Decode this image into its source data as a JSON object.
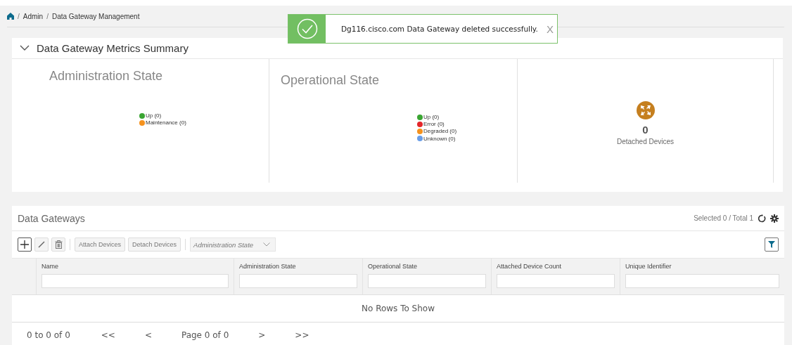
{
  "breadcrumb": {
    "separator": "/",
    "items": [
      "Admin",
      "Data Gateway Management"
    ]
  },
  "toast": {
    "message": "Dg116.cisco.com Data Gateway deleted successfully.",
    "close": "X"
  },
  "summary": {
    "title": "Data Gateway Metrics Summary",
    "expanded": true,
    "admin_state": {
      "title": "Administration State",
      "legend": [
        {
          "label": "Up (0)",
          "color": "#3aa532"
        },
        {
          "label": "Maintenance (0)",
          "color": "#f5921e"
        }
      ]
    },
    "operational_state": {
      "title": "Operational State",
      "legend": [
        {
          "label": "Up (0)",
          "color": "#3aa532"
        },
        {
          "label": "Error (0)",
          "color": "#e3262b"
        },
        {
          "label": "Degraded (0)",
          "color": "#f5921e"
        },
        {
          "label": "Unknown (0)",
          "color": "#6a9ee8"
        }
      ]
    },
    "detached": {
      "count": "0",
      "label": "Detached Devices"
    }
  },
  "gateways": {
    "title": "Data Gateways",
    "selection": "Selected 0 / Total 1",
    "toolbar": {
      "buttons": [
        "Attach Devices",
        "Detach Devices"
      ],
      "dropdown": "Administration State"
    },
    "columns": [
      "Name",
      "Administration State",
      "Operational State",
      "Attached Device Count",
      "Unique Identifier"
    ],
    "empty": "No Rows To Show",
    "pager": {
      "range": "0 to 0 of 0",
      "first": "<<",
      "prev": "<",
      "page": "Page 0 of 0",
      "next": ">",
      "last": ">>"
    }
  }
}
